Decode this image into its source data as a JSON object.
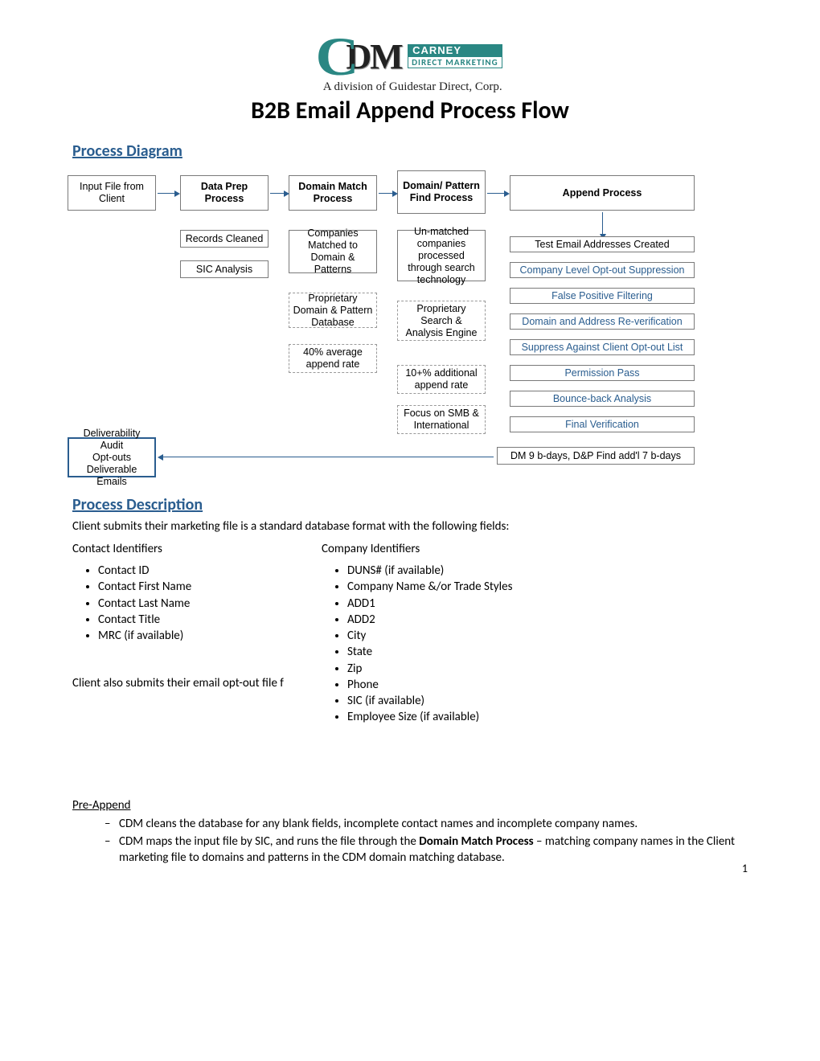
{
  "logo": {
    "company_top": "CARNEY",
    "company_bottom": "DIRECT MARKETING",
    "tagline": "A division of Guidestar Direct, Corp."
  },
  "title": "B2B Email Append Process Flow",
  "section_diagram": "Process Diagram",
  "section_description": "Process Description",
  "diagram": {
    "row1": [
      "Input File from Client",
      "Data Prep Process",
      "Domain Match Process",
      "Domain/ Pattern Find Process",
      "Append Process"
    ],
    "col2": [
      "Records Cleaned",
      "SIC Analysis"
    ],
    "col3": [
      "Companies Matched to Domain & Patterns",
      "Proprietary Domain & Pattern Database",
      "40% average append rate"
    ],
    "col4": [
      "Un-matched companies processed through search technology",
      "Proprietary Search & Analysis Engine",
      "10+% additional append rate",
      "Focus on SMB & International"
    ],
    "col5": [
      "Test Email Addresses Created",
      "Company Level Opt-out Suppression",
      "False Positive Filtering",
      "Domain and Address Re-verification",
      "Suppress Against Client Opt-out List",
      "Permission Pass",
      "Bounce-back Analysis",
      "Final Verification",
      "DM 9 b-days, D&P Find add'l 7 b-days"
    ],
    "outbox": "Deliverability Audit\nOpt-outs\nDeliverable Emails"
  },
  "desc_intro": "Client submits their marketing file is a standard database format with the following fields:",
  "contact_header": "Contact Identifiers",
  "company_header": "Company Identifiers",
  "contact_fields": [
    "Contact ID",
    "Contact First Name",
    "Contact Last Name",
    "Contact Title",
    "MRC (if available)"
  ],
  "company_fields": [
    "DUNS# (if available)",
    "Company Name &/or Trade Styles",
    "ADD1",
    "ADD2",
    "City",
    "State",
    "Zip",
    "Phone",
    "SIC (if available)",
    "Employee Size (if available)"
  ],
  "optout_line": "Client also submits their email opt-out file f",
  "preappend_header": "Pre-Append",
  "preappend_items": [
    "CDM cleans the database for any blank fields, incomplete contact names and incomplete company names.",
    "CDM maps the input file by SIC, and runs the file through the <b>Domain Match Process</b> – matching company names in the Client marketing file to domains and patterns in the CDM domain matching database."
  ],
  "page_number": "1"
}
